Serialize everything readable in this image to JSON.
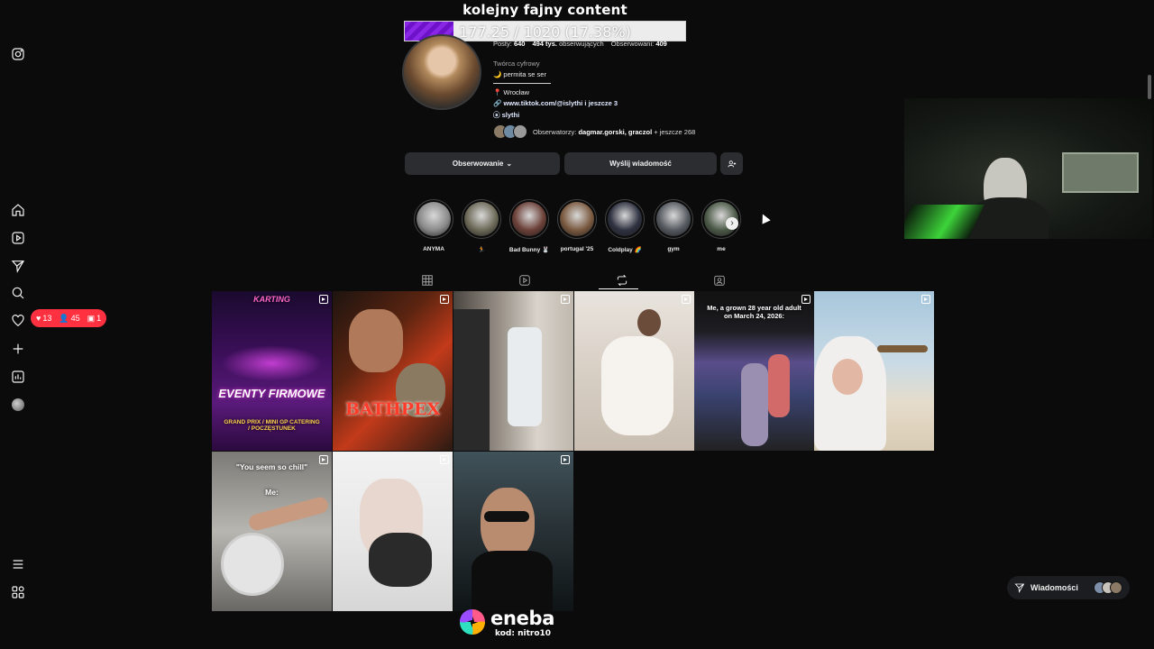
{
  "overlay": {
    "goal_title": "kolejny fajny content",
    "goal_text": "177.25 / 1020 (17.38%)",
    "goal_progress": 0.1738
  },
  "notifications": {
    "likes": "13",
    "follows": "45",
    "other": "1"
  },
  "profile": {
    "stats": {
      "posts_label": "Posty:",
      "posts": "640",
      "followers": "494 tys.",
      "followers_label": "obserwujących",
      "following_label": "Obserwowani:",
      "following": "409"
    },
    "category": "Twórca cyfrowy",
    "bio_line": "🌙 permita se ser",
    "location": "📍 Wrocław",
    "link": "www.tiktok.com/@islythi i jeszcze 3",
    "threads": "slythi",
    "followed_by_label": "Obserwatorzy:",
    "followed_by_names": "dagmar.gorski, graczol",
    "followed_by_more": "+ jeszcze 268",
    "buttons": {
      "following": "Obserwowanie",
      "message": "Wyślij wiadomość"
    }
  },
  "highlights": [
    {
      "label": "ANYMA",
      "color": "#8a8a8a"
    },
    {
      "label": "🏃",
      "color": "#6d6a58"
    },
    {
      "label": "Bad Bunny 🐰",
      "color": "#6b4038"
    },
    {
      "label": "portugal '25",
      "color": "#7b5a40"
    },
    {
      "label": "Coldplay 🌈",
      "color": "#2e3140"
    },
    {
      "label": "gym",
      "color": "#555a60"
    },
    {
      "label": "me",
      "color": "#4d5a48"
    }
  ],
  "tiles": {
    "t1_text": "EVENTY FIRMOWE",
    "t1_sub": "GRAND PRIX / MINI GP CATERING / POCZĘSTUNEK",
    "t1_top": "KARTING",
    "t2_text": "BATHPEX",
    "t5_caption": "Me, a grown 28 year old adult on March 24, 2026:",
    "t7_caption": "\"You seem so chill\"",
    "t7_sub": "Me:"
  },
  "messages": {
    "label": "Wiadomości"
  },
  "sponsor": {
    "name": "eneba",
    "code": "kod: nitro10"
  },
  "icons": [
    "instagram-icon",
    "home-icon",
    "reels-icon",
    "send-icon",
    "search-icon",
    "heart-icon",
    "create-icon",
    "stats-icon",
    "menu-icon",
    "meta-icon",
    "grid-icon",
    "repost-icon",
    "tagged-icon"
  ]
}
